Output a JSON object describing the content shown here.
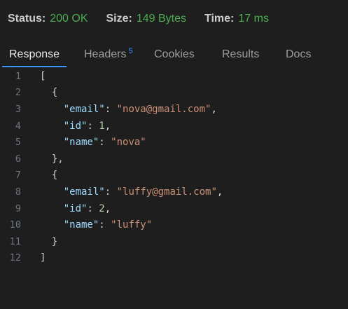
{
  "status": {
    "status_label": "Status:",
    "status_value": "200 OK",
    "size_label": "Size:",
    "size_value": "149 Bytes",
    "time_label": "Time:",
    "time_value": "17 ms"
  },
  "tabs": [
    {
      "label": "Response",
      "active": true
    },
    {
      "label": "Headers",
      "badge": "5"
    },
    {
      "label": "Cookies"
    },
    {
      "label": "Results"
    },
    {
      "label": "Docs"
    }
  ],
  "editor": {
    "lines": [
      {
        "n": "1",
        "tokens": [
          {
            "t": "[",
            "c": "punc"
          }
        ]
      },
      {
        "n": "2",
        "tokens": [
          {
            "t": "  {",
            "c": "punc"
          }
        ]
      },
      {
        "n": "3",
        "tokens": [
          {
            "t": "    ",
            "c": "punc"
          },
          {
            "t": "\"email\"",
            "c": "key"
          },
          {
            "t": ": ",
            "c": "punc"
          },
          {
            "t": "\"nova@gmail.com\"",
            "c": "str"
          },
          {
            "t": ",",
            "c": "punc"
          }
        ]
      },
      {
        "n": "4",
        "tokens": [
          {
            "t": "    ",
            "c": "punc"
          },
          {
            "t": "\"id\"",
            "c": "key"
          },
          {
            "t": ": ",
            "c": "punc"
          },
          {
            "t": "1",
            "c": "num"
          },
          {
            "t": ",",
            "c": "punc"
          }
        ]
      },
      {
        "n": "5",
        "tokens": [
          {
            "t": "    ",
            "c": "punc"
          },
          {
            "t": "\"name\"",
            "c": "key"
          },
          {
            "t": ": ",
            "c": "punc"
          },
          {
            "t": "\"nova\"",
            "c": "str"
          }
        ]
      },
      {
        "n": "6",
        "tokens": [
          {
            "t": "  },",
            "c": "punc"
          }
        ]
      },
      {
        "n": "7",
        "tokens": [
          {
            "t": "  {",
            "c": "punc"
          }
        ]
      },
      {
        "n": "8",
        "tokens": [
          {
            "t": "    ",
            "c": "punc"
          },
          {
            "t": "\"email\"",
            "c": "key"
          },
          {
            "t": ": ",
            "c": "punc"
          },
          {
            "t": "\"luffy@gmail.com\"",
            "c": "str"
          },
          {
            "t": ",",
            "c": "punc"
          }
        ]
      },
      {
        "n": "9",
        "tokens": [
          {
            "t": "    ",
            "c": "punc"
          },
          {
            "t": "\"id\"",
            "c": "key"
          },
          {
            "t": ": ",
            "c": "punc"
          },
          {
            "t": "2",
            "c": "num"
          },
          {
            "t": ",",
            "c": "punc"
          }
        ]
      },
      {
        "n": "10",
        "tokens": [
          {
            "t": "    ",
            "c": "punc"
          },
          {
            "t": "\"name\"",
            "c": "key"
          },
          {
            "t": ": ",
            "c": "punc"
          },
          {
            "t": "\"luffy\"",
            "c": "str"
          }
        ]
      },
      {
        "n": "11",
        "tokens": [
          {
            "t": "  }",
            "c": "punc"
          }
        ]
      },
      {
        "n": "12",
        "tokens": [
          {
            "t": "]",
            "c": "punc"
          }
        ]
      }
    ]
  },
  "colors": {
    "background": "#1e1e1e",
    "status_ok": "#4caf50",
    "active_tab_underline": "#3794ff",
    "json_key": "#9cdcfe",
    "json_string": "#ce9178",
    "json_number": "#b5cea8"
  }
}
